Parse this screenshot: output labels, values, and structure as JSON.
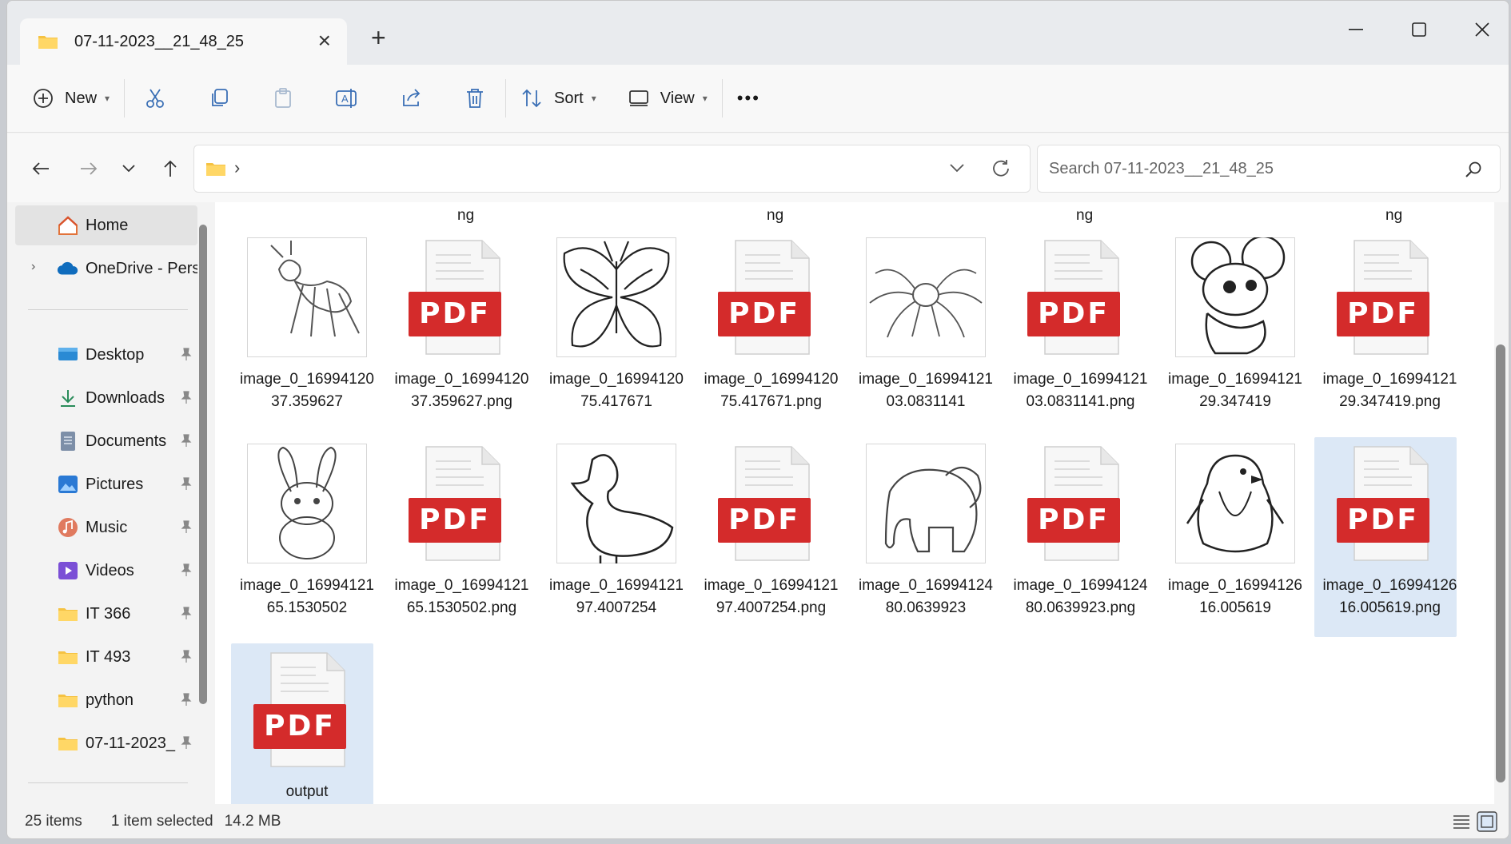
{
  "window": {
    "tab_title": "07-11-2023__21_48_25",
    "new_tab": "+"
  },
  "toolbar": {
    "new_label": "New",
    "sort_label": "Sort",
    "view_label": "View",
    "more_label": "•••"
  },
  "address": {
    "separator": "›"
  },
  "search": {
    "placeholder": "Search 07-11-2023__21_48_25"
  },
  "sidebar": {
    "home": "Home",
    "onedrive": "OneDrive - Persc",
    "items": [
      {
        "label": "Desktop"
      },
      {
        "label": "Downloads"
      },
      {
        "label": "Documents"
      },
      {
        "label": "Pictures"
      },
      {
        "label": "Music"
      },
      {
        "label": "Videos"
      },
      {
        "label": "IT 366"
      },
      {
        "label": "IT 493"
      },
      {
        "label": "python"
      },
      {
        "label": "07-11-2023_"
      }
    ]
  },
  "top_row_labels": [
    "ng",
    "ng",
    "ng",
    "ng"
  ],
  "files": [
    {
      "label": "image_0_1699412037.359627",
      "type": "image",
      "icon": "ant-drawing"
    },
    {
      "label": "image_0_1699412037.359627.png",
      "type": "pdf"
    },
    {
      "label": "image_0_1699412075.417671",
      "type": "image",
      "icon": "butterfly-drawing"
    },
    {
      "label": "image_0_1699412075.417671.png",
      "type": "pdf"
    },
    {
      "label": "image_0_1699412103.0831141",
      "type": "image",
      "icon": "spider-drawing"
    },
    {
      "label": "image_0_1699412103.0831141.png",
      "type": "pdf"
    },
    {
      "label": "image_0_1699412129.347419",
      "type": "image",
      "icon": "mouse-drawing"
    },
    {
      "label": "image_0_1699412129.347419.png",
      "type": "pdf"
    },
    {
      "label": "image_0_1699412165.1530502",
      "type": "image",
      "icon": "rabbit-drawing"
    },
    {
      "label": "image_0_1699412165.1530502.png",
      "type": "pdf"
    },
    {
      "label": "image_0_1699412197.4007254",
      "type": "image",
      "icon": "duck-drawing"
    },
    {
      "label": "image_0_1699412197.4007254.png",
      "type": "pdf"
    },
    {
      "label": "image_0_1699412480.0639923",
      "type": "image",
      "icon": "elephant-drawing"
    },
    {
      "label": "image_0_1699412480.0639923.png",
      "type": "pdf"
    },
    {
      "label": "image_0_1699412616.005619",
      "type": "image",
      "icon": "penguin-drawing"
    },
    {
      "label": "image_0_1699412616.005619.png",
      "type": "pdf"
    },
    {
      "label": "output",
      "type": "pdf"
    }
  ],
  "pdf_badge": "PDF",
  "status": {
    "items": "25 items",
    "selected": "1 item selected",
    "size": "14.2 MB"
  },
  "colors": {
    "pdf_red": "#d42b2b",
    "selection": "#dce8f6",
    "accent": "#0067c0"
  }
}
